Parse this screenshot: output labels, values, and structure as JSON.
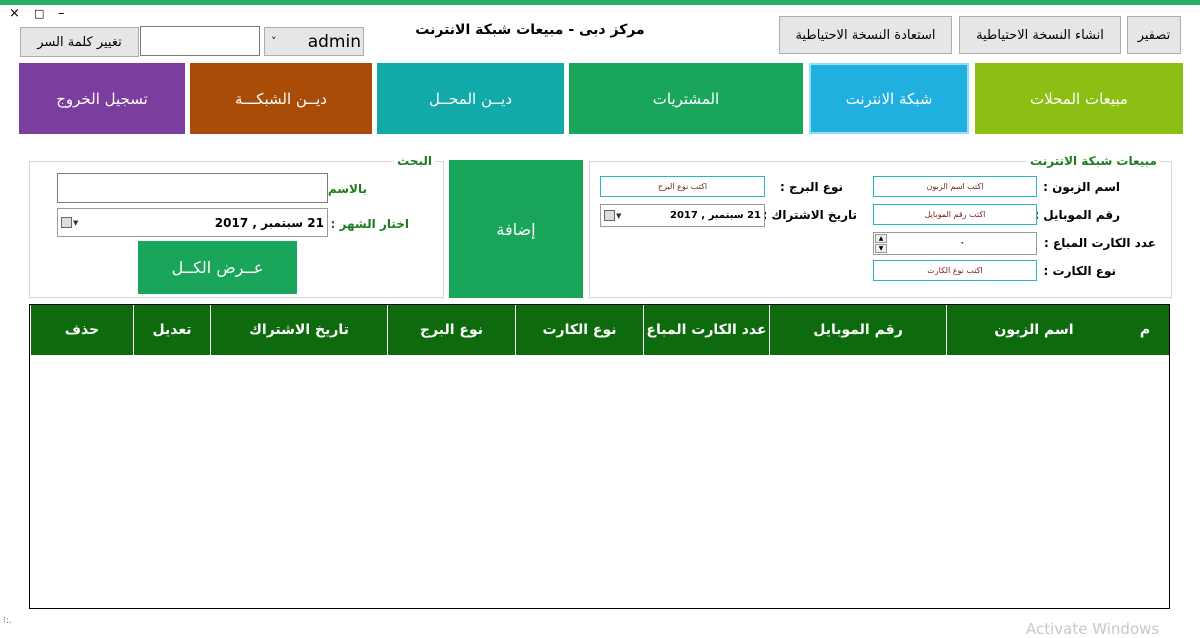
{
  "window": {
    "close_glyph": "×",
    "maximize_glyph": "□",
    "minimize_glyph": "–",
    "title": "مركز دبى - مبيعات شبكة الانترنت"
  },
  "toolbar": {
    "clear_label": "تصفير",
    "create_backup_label": "انشاء النسخة الاحتياطية",
    "restore_backup_label": "استعادة النسخة الاحتياطية",
    "change_password_label": "تغيير كلمة السر",
    "password_value": "",
    "user_value": "admin",
    "user_arrow": "˅"
  },
  "tiles": [
    {
      "label": "مبيعات المحلات",
      "color": "#8cbf13"
    },
    {
      "label": "شبكة الانترنت",
      "color": "#1fb0e0"
    },
    {
      "label": "المشتريات",
      "color": "#1aa65a"
    },
    {
      "label": "ديــن المحــل",
      "color": "#12a9a9"
    },
    {
      "label": "ديــن الشبكـــة",
      "color": "#a94c08"
    },
    {
      "label": "تسجيل الخروج",
      "color": "#7b3d9e"
    }
  ],
  "sales_form": {
    "group_title": "مبيعات شبكة الانترنت",
    "customer_label": "اسم الزبون :",
    "customer_placeholder": "اكتب اسم الزبون",
    "mobile_label": "رقم الموبايل :",
    "mobile_placeholder": "اكتب رقم الموبايل",
    "cards_label": "عدد الكارت المباع :",
    "cards_value": "٠",
    "card_type_label": "نوع الكارت :",
    "card_type_placeholder": "اكتب نوع الكارت",
    "tower_label": "نوع البرج :",
    "tower_placeholder": "اكتب نوع البرج",
    "date_label": "تاريخ الاشتراك :",
    "date_value": "21  سبتمبر , 2017"
  },
  "add_button_label": "إضافة",
  "search": {
    "group_title": "البحث",
    "name_label": "بالاسم :",
    "name_value": "",
    "month_label": "اختار الشهر :",
    "month_value": "21  سبتمبر , 2017",
    "show_all_label": "عــرض الكــل"
  },
  "table": {
    "columns": [
      {
        "label": "م"
      },
      {
        "label": "اسم الزبون"
      },
      {
        "label": "رقم الموبايل"
      },
      {
        "label": "عدد الكارت المباع"
      },
      {
        "label": "نوع الكارت"
      },
      {
        "label": "نوع البرج"
      },
      {
        "label": "تاريخ الاشتراك"
      },
      {
        "label": "تعديل"
      },
      {
        "label": "حذف"
      }
    ],
    "rows": []
  },
  "watermark": "Activate Windows",
  "status_dots": "⁝:."
}
